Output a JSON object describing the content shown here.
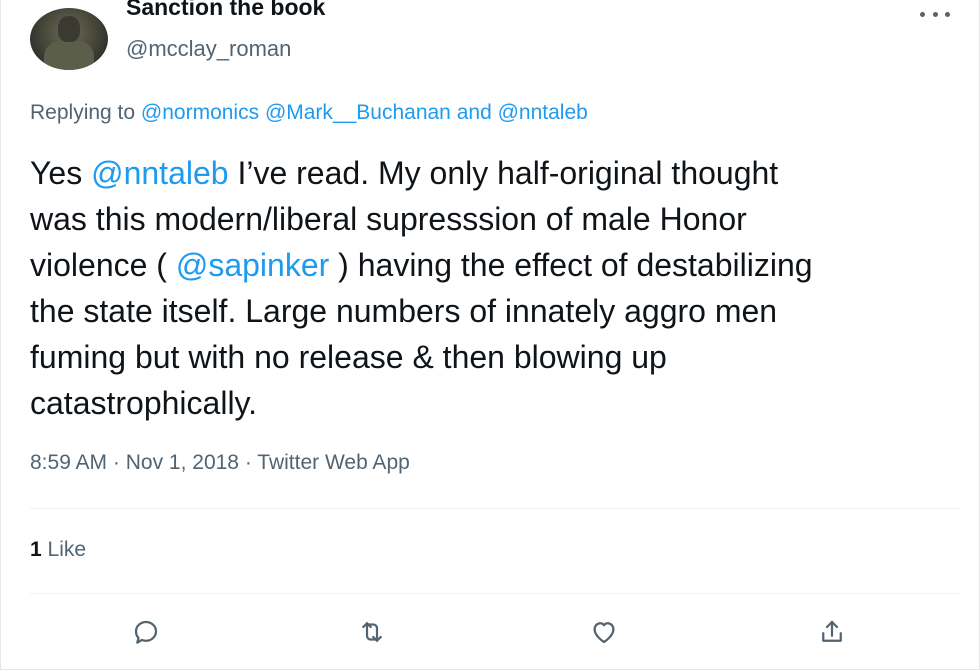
{
  "author": {
    "display_name": "Sanction the book",
    "handle": "@mcclay_roman",
    "avatar_icon": "avatar-photo"
  },
  "replying": {
    "prefix": "Replying to",
    "mentions": [
      "@normonics",
      "@Mark__Buchanan",
      "@nntaleb"
    ],
    "conjunction": "and"
  },
  "tweet": {
    "lines": [
      [
        "Yes ",
        "@nntaleb",
        " I’ve read. My only half-original thought"
      ],
      [
        "was this modern/liberal supresssion of male Honor"
      ],
      [
        "violence ( ",
        "@sapinker",
        " ) having the effect of destabilizing"
      ],
      [
        "the state itself. Large numbers of innately aggro men"
      ],
      [
        "fuming but with no release & then blowing up"
      ],
      [
        "catastrophically."
      ]
    ]
  },
  "meta": {
    "time": "8:59 AM",
    "separator": " · ",
    "date": "Nov 1, 2018",
    "source": "Twitter Web App"
  },
  "stats": {
    "likes_count": "1",
    "likes_label": "Like"
  },
  "actions": [
    {
      "name": "reply",
      "icon": "reply-icon"
    },
    {
      "name": "retweet",
      "icon": "retweet-icon"
    },
    {
      "name": "like",
      "icon": "heart-icon"
    },
    {
      "name": "share",
      "icon": "share-icon"
    }
  ],
  "colors": {
    "link": "#1d9bf0",
    "secondary_text": "#536471",
    "primary_text": "#0f1419"
  }
}
